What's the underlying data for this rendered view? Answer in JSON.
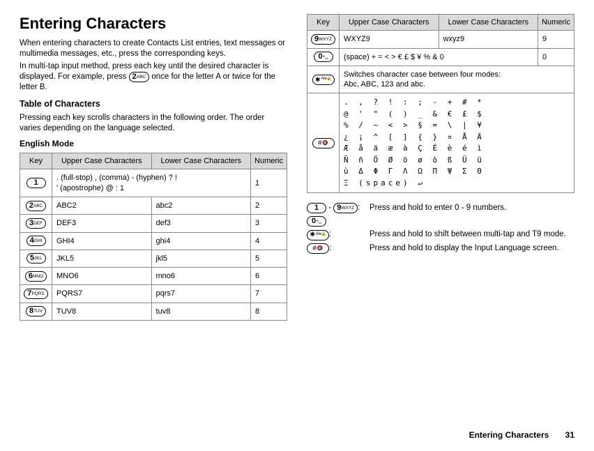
{
  "heading": "Entering Characters",
  "intro1": "When entering characters to create Contacts List entries, text messages or multimedia messages, etc., press the corresponding keys.",
  "intro2_a": "In multi-tap input method, press each key until the desired character is displayed. For example, press ",
  "intro2_b": " once for the letter A or twice for the letter B.",
  "table_heading": "Table of Characters",
  "table_intro": "Pressing each key scrolls characters in the following order. The order varies depending on the language selected.",
  "mode_label": "English Mode",
  "cols": {
    "key": "Key",
    "upper": "Upper Case Characters",
    "lower": "Lower Case Characters",
    "numeric": "Numeric"
  },
  "rows_left": [
    {
      "maj": "1",
      "sub": "",
      "upper_span": ". (full-stop) , (comma) - (hyphen) ? !\n' (apostrophe) @ : 1",
      "num": "1"
    },
    {
      "maj": "2",
      "sub": "ABC",
      "upper": "ABC2",
      "lower": "abc2",
      "num": "2"
    },
    {
      "maj": "3",
      "sub": "DEF",
      "upper": "DEF3",
      "lower": "def3",
      "num": "3"
    },
    {
      "maj": "4",
      "sub": "GHI",
      "upper": "GHI4",
      "lower": "ghi4",
      "num": "4"
    },
    {
      "maj": "5",
      "sub": "JKL",
      "upper": "JKL5",
      "lower": "jkl5",
      "num": "5"
    },
    {
      "maj": "6",
      "sub": "MNO",
      "upper": "MNO6",
      "lower": "mno6",
      "num": "6"
    },
    {
      "maj": "7",
      "sub": "PQRS",
      "upper": "PQRS7",
      "lower": "pqrs7",
      "num": "7"
    },
    {
      "maj": "8",
      "sub": "TUV",
      "upper": "TUV8",
      "lower": "tuv8",
      "num": "8"
    }
  ],
  "rows_right": [
    {
      "maj": "9",
      "sub": "WXYZ",
      "upper": "WXYZ9",
      "lower": "wxyz9",
      "num": "9"
    },
    {
      "maj": "0",
      "sub": "+␣",
      "upper_span": "(space) + = < > € £ $ ¥ % & 0",
      "num_right": "0"
    },
    {
      "special": "star",
      "span_text": "Switches character case between four modes:\nAbc, ABC, 123 and abc."
    }
  ],
  "symbols_block": ". , ? ! : ; - + # *\n@ ' \" ( ) _ & € £ $\n% / ~ < > § = \\ | ¥\n¿ ¡ ^ [ ] { } ¤ Å Ä\nÆ å ä æ à Ç É è é ì\nÑ ñ Ö Ø ö ø ò ß Ü ü\nù Δ Φ Γ Λ Ω Π Ψ Σ Θ\nΞ (space) ↵",
  "hints": {
    "range_prefix_maj": "1",
    "range_prefix_sub": "",
    "range_dash": "-",
    "range_suffix_maj": "9",
    "range_suffix_sub": "WXYZ",
    "range_colon": ":",
    "range_text": "Press and hold to enter 0 - 9 numbers.",
    "zero_maj": "0",
    "zero_sub": "+␣",
    "star_colon": ":",
    "star_text": "Press and hold to shift between multi-tap and T9 mode.",
    "hash_colon": ":",
    "hash_text": "Press and hold to display the Input Language screen."
  },
  "footer": {
    "title": "Entering Characters",
    "page": "31"
  }
}
